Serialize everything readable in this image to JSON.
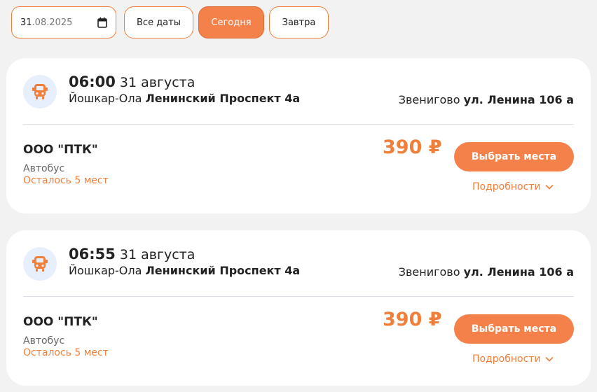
{
  "filters": {
    "date_value_day": "31",
    "date_value_rest": ".08.2025",
    "all_dates": "Все даты",
    "today": "Сегодня",
    "tomorrow": "Завтра",
    "active": "today"
  },
  "trips": [
    {
      "time": "06:00",
      "date": "31 августа",
      "from_city": "Йошкар-Ола",
      "from_stop": "Ленинский Проспект 4а",
      "to_city": "Звенигово",
      "to_stop": "ул. Ленина 106 а",
      "carrier": "ООО \"ПТК\"",
      "vehicle": "Автобус",
      "seats_left": "Осталось 5 мест",
      "price": "390 ₽",
      "select_label": "Выбрать места",
      "details_label": "Подробности"
    },
    {
      "time": "06:55",
      "date": "31 августа",
      "from_city": "Йошкар-Ола",
      "from_stop": "Ленинский Проспект 4а",
      "to_city": "Звенигово",
      "to_stop": "ул. Ленина 106 а",
      "carrier": "ООО \"ПТК\"",
      "vehicle": "Автобус",
      "seats_left": "Осталось 5 мест",
      "price": "390 ₽",
      "select_label": "Выбрать места",
      "details_label": "Подробности"
    }
  ],
  "colors": {
    "accent": "#f4804a",
    "accent_text": "#f07f3c",
    "icon_bg": "#e6effb",
    "page_bg": "#f2f2f2"
  },
  "icons": {
    "calendar": "calendar-icon",
    "bus": "bus-icon",
    "chevron": "chevron-down-icon"
  }
}
